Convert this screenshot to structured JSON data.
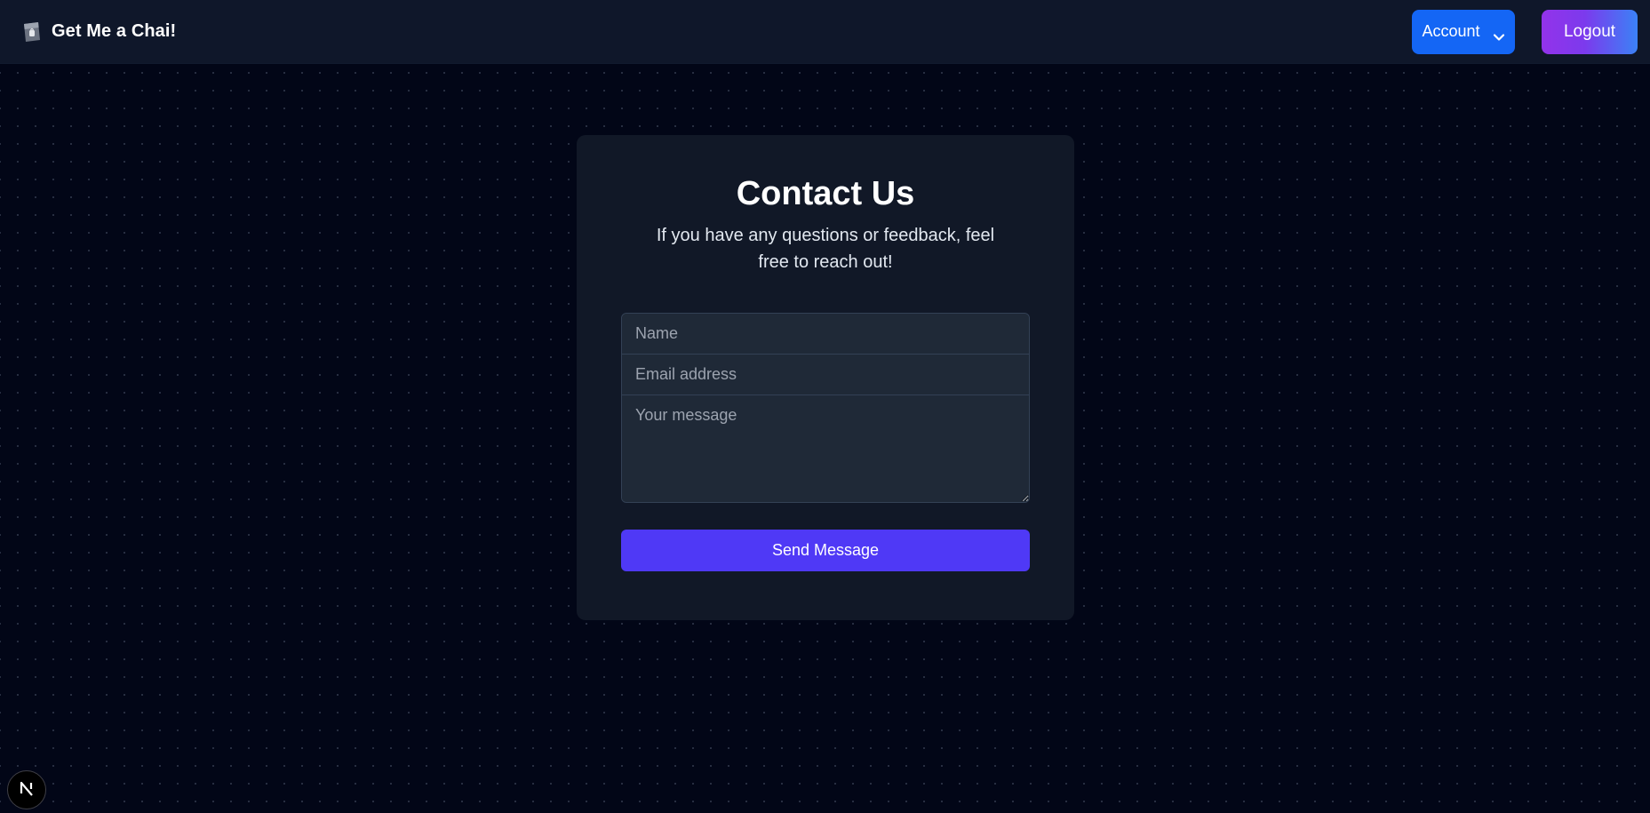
{
  "navbar": {
    "brand_label": "Get Me a Chai!",
    "brand_icon": "chai-cup-icon",
    "account_label": "Account",
    "account_icon": "chevron-down-icon",
    "logout_label": "Logout"
  },
  "contact": {
    "title": "Contact Us",
    "subtitle": "If you have any questions or feedback, feel free to reach out!",
    "name_placeholder": "Name",
    "email_placeholder": "Email address",
    "message_placeholder": "Your message",
    "name_value": "",
    "email_value": "",
    "message_value": "",
    "submit_label": "Send Message"
  },
  "dev_badge": {
    "icon": "nextjs-logo-icon"
  },
  "colors": {
    "background": "#020617",
    "navbar": "#0f172a",
    "card": "#111827",
    "input": "#1f2937",
    "account_button": "#1466f5",
    "logout_gradient_start": "#9333ea",
    "logout_gradient_end": "#3b82f6",
    "submit_button": "#4f39f6"
  }
}
